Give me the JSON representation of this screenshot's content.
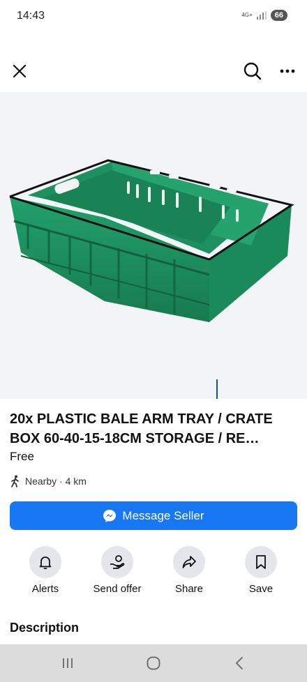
{
  "status_bar": {
    "time": "14:43",
    "network": "4G+",
    "battery": "66"
  },
  "listing": {
    "title": "20x PLASTIC BALE ARM TRAY / CRATE BOX 60-40-15-18CM STORAGE / RE…",
    "price": "Free",
    "location": "Nearby · 4 km",
    "message_button": "Message Seller"
  },
  "actions": [
    {
      "label": "Alerts",
      "icon": "bell-icon"
    },
    {
      "label": "Send offer",
      "icon": "send-offer-icon"
    },
    {
      "label": "Share",
      "icon": "share-icon"
    },
    {
      "label": "Save",
      "icon": "bookmark-icon"
    }
  ],
  "description": {
    "heading": "Description"
  },
  "colors": {
    "accent": "#1877f2",
    "crate": "#1f8a5c",
    "crate_rim": "#111111"
  }
}
